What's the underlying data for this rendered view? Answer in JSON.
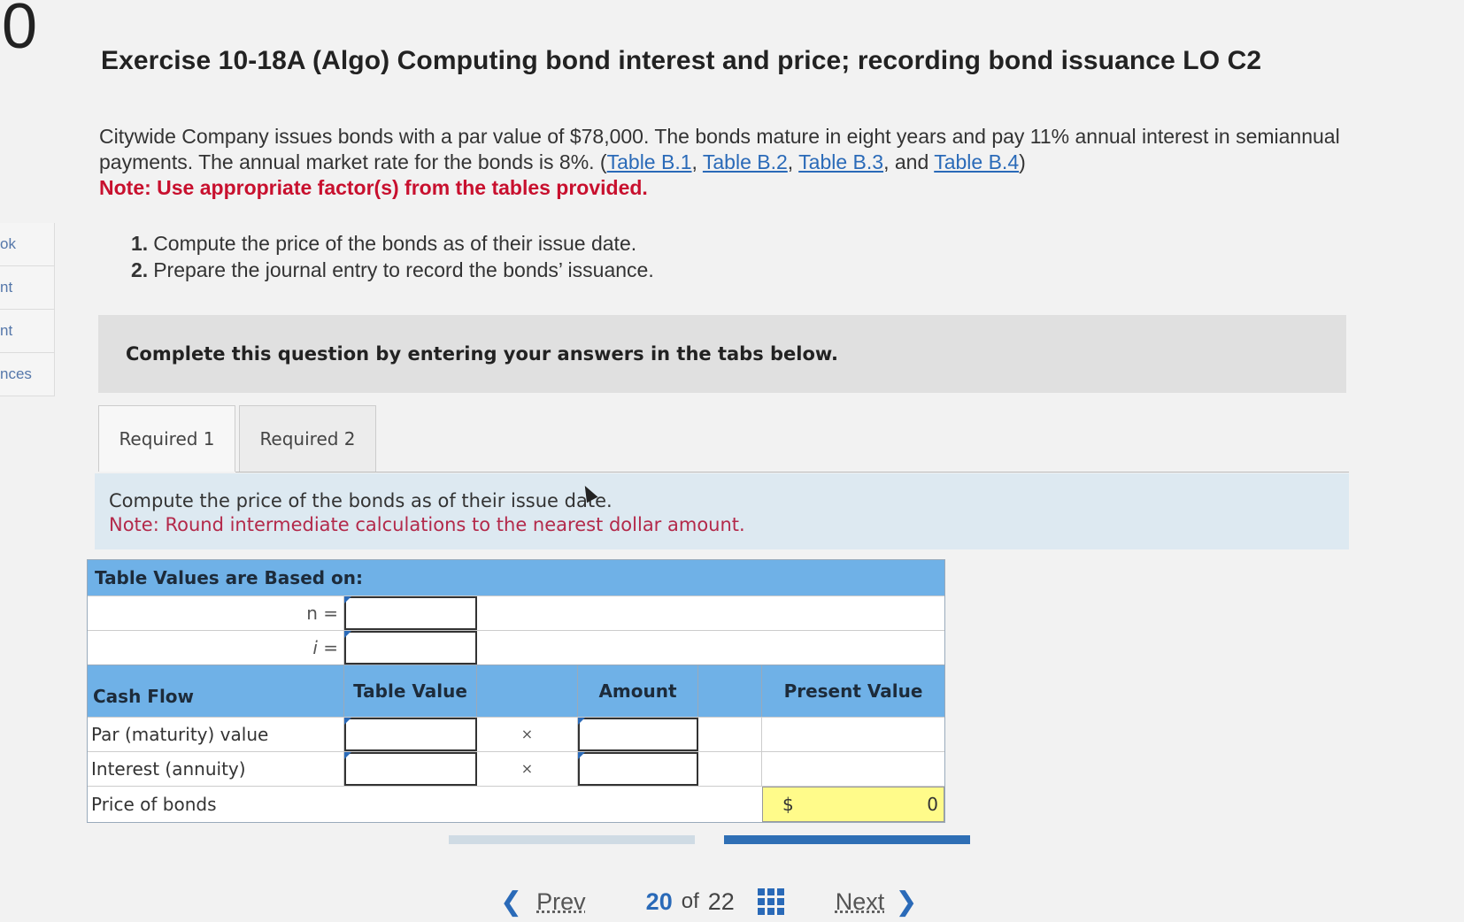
{
  "timer_digit": "0",
  "sidenav": [
    "ok",
    "nt",
    "nt",
    "nces"
  ],
  "title": "Exercise 10-18A (Algo) Computing bond interest and price; recording bond issuance LO C2",
  "problem": {
    "text1": "Citywide Company issues bonds with a par value of $78,000. The bonds mature in eight years and pay 11% annual interest in semiannual payments. The annual market rate for the bonds is 8%. (",
    "links": [
      "Table B.1",
      "Table B.2",
      "Table B.3",
      "Table B.4"
    ],
    "sep1": ", ",
    "sep2": ", ",
    "sep3": ", and ",
    "close": ")",
    "note": "Note: Use appropriate factor(s) from the tables provided."
  },
  "requirements": [
    {
      "num": "1.",
      "text": "Compute the price of the bonds as of their issue date."
    },
    {
      "num": "2.",
      "text": "Prepare the journal entry to record the bonds’ issuance."
    }
  ],
  "instruction": "Complete this question by entering your answers in the tabs below.",
  "tabs": [
    "Required 1",
    "Required 2"
  ],
  "task": {
    "line1": "Compute the price of the bonds as of their issue date.",
    "line2": "Note: Round intermediate calculations to the nearest dollar amount."
  },
  "table": {
    "based_on": "Table Values are Based on:",
    "n_label": "n =",
    "i_label": "i =",
    "headers": [
      "Cash Flow",
      "Table Value",
      "Amount",
      "Present Value"
    ],
    "rows": [
      {
        "label": "Par (maturity) value",
        "op": "×"
      },
      {
        "label": "Interest (annuity)",
        "op": "×"
      }
    ],
    "price_label": "Price of bonds",
    "currency": "$",
    "price_value": "0"
  },
  "pager": {
    "prev": "Prev",
    "current": "20",
    "of": "of",
    "total": "22",
    "next": "Next"
  },
  "colors": {
    "header_blue": "#6fb1e7",
    "link_blue": "#2a6ab8",
    "note_red": "#c8102e",
    "highlight_yellow": "#fffb8a"
  }
}
